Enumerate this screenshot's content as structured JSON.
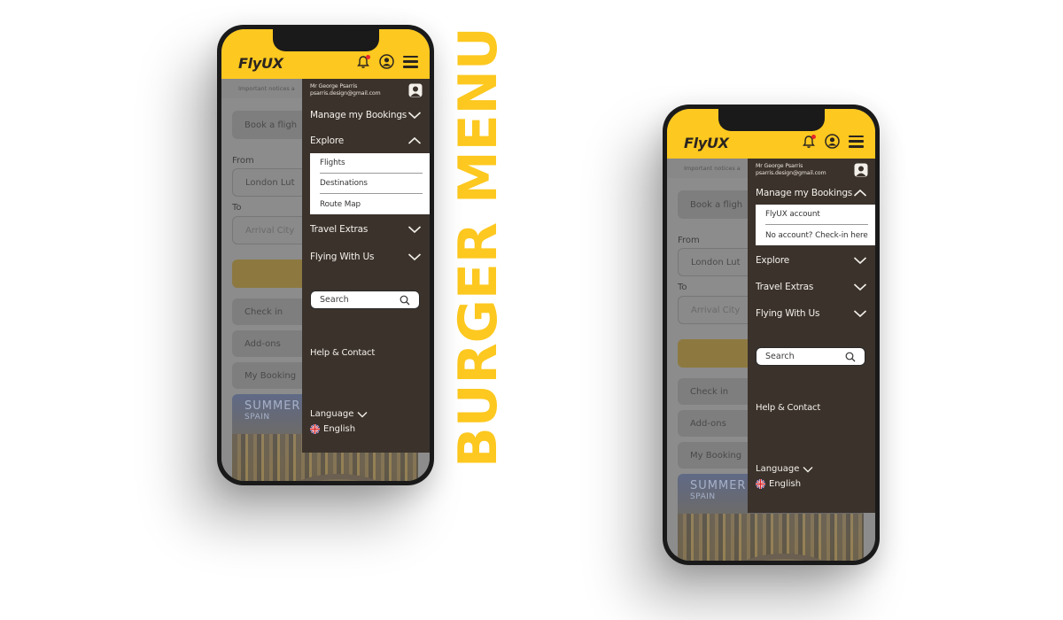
{
  "headline": "BURGER MENU",
  "colors": {
    "brand_yellow": "#fdc81f",
    "drawer_bg": "#3b322c",
    "notification_dot": "#e8262a",
    "dark_text": "#2b2520"
  },
  "phones": [
    {
      "app": {
        "logo": "FlyUX",
        "icons": [
          "bell-icon",
          "account-icon",
          "hamburger-icon"
        ],
        "notification_badge": true
      },
      "background": {
        "notice": "Important notices a",
        "book_flight": "Book a fligh",
        "from_label": "From",
        "from_value": "London Lut",
        "to_label": "To",
        "to_placeholder": "Arrival City",
        "quick_links": [
          "Check in",
          "Add-ons",
          "My Booking"
        ],
        "promo_title": "SUMMER",
        "promo_subtitle": "SPAIN"
      },
      "drawer": {
        "user_name": "Mr George Psarris",
        "user_email": "psarris.design@gmail.com",
        "items": [
          {
            "label": "Manage my Bookings",
            "expanded": false
          },
          {
            "label": "Explore",
            "expanded": true,
            "children": [
              "Flights",
              "Destinations",
              "Route Map"
            ]
          },
          {
            "label": "Travel Extras",
            "expanded": false
          },
          {
            "label": "Flying With Us",
            "expanded": false
          }
        ],
        "search_placeholder": "Search",
        "help": "Help & Contact",
        "language_label": "Language",
        "language_value": "English"
      }
    },
    {
      "app": {
        "logo": "FlyUX",
        "icons": [
          "bell-icon",
          "account-icon",
          "hamburger-icon"
        ],
        "notification_badge": true
      },
      "background": {
        "notice": "Important notices a",
        "book_flight": "Book a fligh",
        "from_label": "From",
        "from_value": "London Lut",
        "to_label": "To",
        "to_placeholder": "Arrival City",
        "quick_links": [
          "Check in",
          "Add-ons",
          "My Booking"
        ],
        "promo_title": "SUMMER",
        "promo_subtitle": "SPAIN"
      },
      "drawer": {
        "user_name": "Mr George Psarris",
        "user_email": "psarris.design@gmail.com",
        "items": [
          {
            "label": "Manage my Bookings",
            "expanded": true,
            "children": [
              "FlyUX account",
              "No account? Check-in here"
            ]
          },
          {
            "label": "Explore",
            "expanded": false
          },
          {
            "label": "Travel Extras",
            "expanded": false
          },
          {
            "label": "Flying With Us",
            "expanded": false
          }
        ],
        "search_placeholder": "Search",
        "help": "Help & Contact",
        "language_label": "Language",
        "language_value": "English"
      }
    }
  ]
}
